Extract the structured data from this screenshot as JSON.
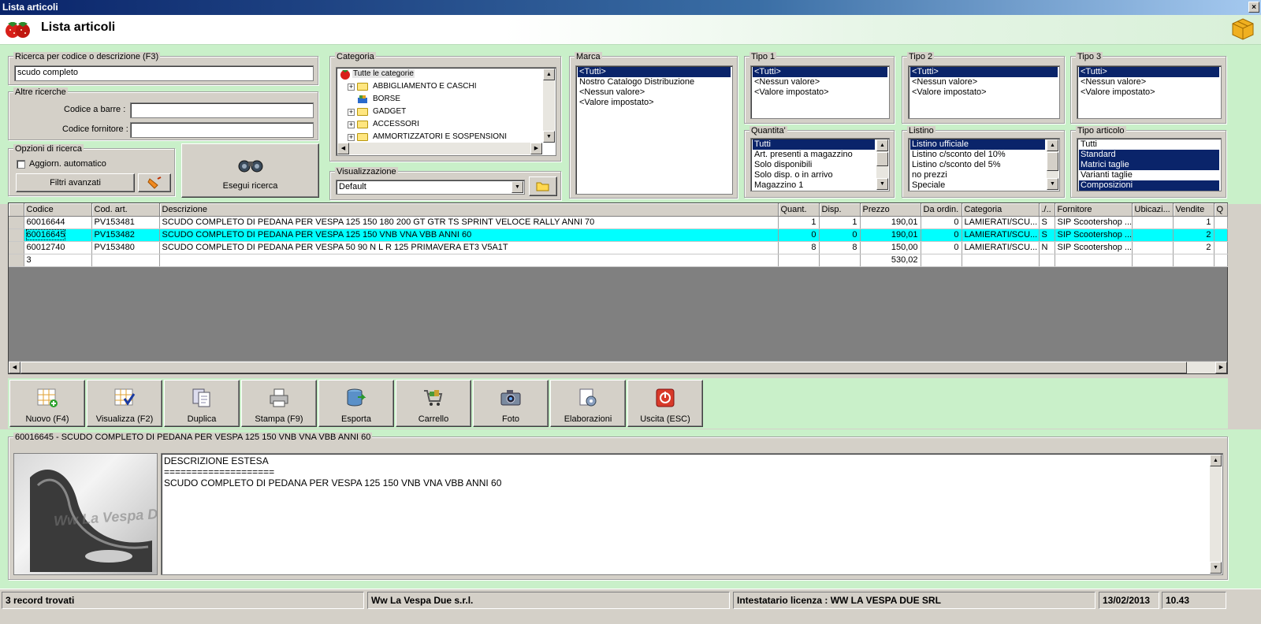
{
  "window": {
    "title": "Lista articoli",
    "close": "×"
  },
  "header": {
    "title": "Lista articoli"
  },
  "search": {
    "group_title": "Ricerca per codice o descrizione (F3)",
    "value": "scudo completo"
  },
  "other_searches": {
    "group_title": "Altre ricerche",
    "barcode_label": "Codice a barre :",
    "barcode_value": "",
    "supplier_code_label": "Codice fornitore :",
    "supplier_code_value": ""
  },
  "search_options": {
    "group_title": "Opzioni di ricerca",
    "auto_update_label": "Aggiorn. automatico",
    "auto_update_checked": false,
    "advanced_filters_label": "Filtri avanzati"
  },
  "run_search_label": "Esegui ricerca",
  "category": {
    "group_title": "Categoria",
    "root": "Tutte le categorie",
    "items": [
      "ABBIGLIAMENTO E CASCHI",
      "BORSE",
      "GADGET",
      "ACCESSORI",
      "AMMORTIZZATORI E SOSPENSIONI"
    ]
  },
  "view": {
    "group_title": "Visualizzazione",
    "value": "Default"
  },
  "brand": {
    "group_title": "Marca",
    "items": [
      "<Tutti>",
      "Nostro Catalogo Distribuzione",
      "<Nessun valore>",
      "<Valore impostato>"
    ],
    "selected": [
      0
    ]
  },
  "type1": {
    "group_title": "Tipo 1",
    "items": [
      "<Tutti>",
      "<Nessun valore>",
      "<Valore impostato>"
    ],
    "selected": [
      0
    ]
  },
  "type2": {
    "group_title": "Tipo 2",
    "items": [
      "<Tutti>",
      "<Nessun valore>",
      "<Valore impostato>"
    ],
    "selected": [
      0
    ]
  },
  "type3": {
    "group_title": "Tipo 3",
    "items": [
      "<Tutti>",
      "<Nessun valore>",
      "<Valore impostato>"
    ],
    "selected": [
      0
    ]
  },
  "quantity": {
    "group_title": "Quantita'",
    "items": [
      "Tutti",
      "Art. presenti a magazzino",
      "Solo disponibili",
      "Solo disp. o in arrivo",
      "Magazzino 1"
    ],
    "selected": [
      0
    ]
  },
  "price_list": {
    "group_title": "Listino",
    "items": [
      "Listino ufficiale",
      "Listino c/sconto del 10%",
      "Listino c/sconto del 5%",
      "no prezzi",
      "Speciale"
    ],
    "selected": [
      0
    ]
  },
  "article_type": {
    "group_title": "Tipo articolo",
    "items": [
      "Tutti",
      "Standard",
      "Matrici taglie",
      "Varianti taglie",
      "Composizioni"
    ],
    "selected": [
      1,
      2,
      4
    ]
  },
  "grid": {
    "columns": [
      "Codice",
      "Cod. art.",
      "Descrizione",
      "Quant.",
      "Disp.",
      "Prezzo",
      "Da ordin.",
      "Categoria",
      "./..",
      "Fornitore",
      "Ubicazi...",
      "Vendite",
      "Q"
    ],
    "rows": [
      [
        "60016644",
        "PV153481",
        "SCUDO COMPLETO DI PEDANA PER VESPA 125 150 180 200 GT GTR TS SPRINT VELOCE RALLY ANNI 70",
        "1",
        "1",
        "190,01",
        "0",
        "LAMIERATI/SCU...",
        "S",
        "SIP Scootershop ...",
        "",
        "1",
        ""
      ],
      [
        "60016645",
        "PV153482",
        "SCUDO COMPLETO DI PEDANA PER VESPA 125 150 VNB VNA VBB ANNI 60",
        "0",
        "0",
        "190,01",
        "0",
        "LAMIERATI/SCU...",
        "S",
        "SIP Scootershop ...",
        "",
        "2",
        ""
      ],
      [
        "60012740",
        "PV153480",
        "SCUDO COMPLETO DI PEDANA PER VESPA 50 90 N L R 125 PRIMAVERA ET3 V5A1T",
        "8",
        "8",
        "150,00",
        "0",
        "LAMIERATI/SCU...",
        "N",
        "SIP Scootershop ...",
        "",
        "2",
        ""
      ]
    ],
    "highlighted_row": 1,
    "totals": [
      "3",
      "",
      "",
      "",
      "",
      "530,02",
      "",
      "",
      "",
      "",
      "",
      "",
      ""
    ]
  },
  "toolbar": {
    "new": "Nuovo (F4)",
    "view": "Visualizza (F2)",
    "duplicate": "Duplica",
    "print": "Stampa (F9)",
    "export": "Esporta",
    "cart": "Carrello",
    "photo": "Foto",
    "processing": "Elaborazioni",
    "exit": "Uscita (ESC)"
  },
  "detail": {
    "group_title": "60016645 - SCUDO COMPLETO DI PEDANA PER VESPA 125 150 VNB VNA VBB ANNI 60",
    "text_lines": [
      "DESCRIZIONE ESTESA",
      "====================",
      "SCUDO COMPLETO DI PEDANA PER VESPA 125 150 VNB VNA VBB ANNI 60"
    ],
    "watermark": "Ww La Vespa Due"
  },
  "status": {
    "records": "3 record trovati",
    "company": "Ww La Vespa Due s.r.l.",
    "license": "Intestatario licenza : WW LA VESPA DUE SRL",
    "date": "13/02/2013",
    "time": "10.43"
  },
  "colors": {
    "highlight_row": "#00ffff",
    "selection": "#0a246a",
    "app_background": "#c9f0c9"
  }
}
